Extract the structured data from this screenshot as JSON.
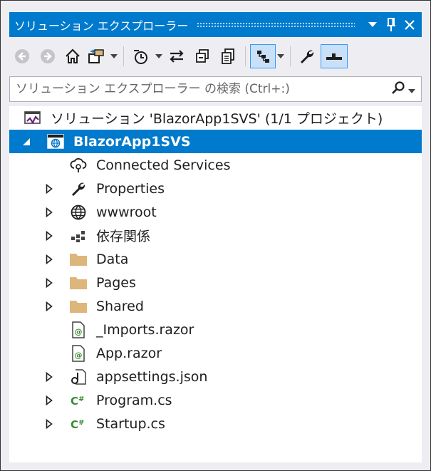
{
  "window": {
    "title": "ソリューション エクスプローラー"
  },
  "search": {
    "placeholder": "ソリューション エクスプローラー の検索 (Ctrl+:)"
  },
  "tree": {
    "solution": "ソリューション 'BlazorApp1SVS' (1/1 プロジェクト)",
    "project": "BlazorApp1SVS",
    "items": [
      {
        "label": "Connected Services",
        "icon": "connected-services-icon",
        "expandable": false
      },
      {
        "label": "Properties",
        "icon": "wrench-icon",
        "expandable": true
      },
      {
        "label": "wwwroot",
        "icon": "globe-icon",
        "expandable": true
      },
      {
        "label": "依存関係",
        "icon": "dependencies-icon",
        "expandable": true
      },
      {
        "label": "Data",
        "icon": "folder-icon",
        "expandable": true
      },
      {
        "label": "Pages",
        "icon": "folder-icon",
        "expandable": true
      },
      {
        "label": "Shared",
        "icon": "folder-icon",
        "expandable": true
      },
      {
        "label": "_Imports.razor",
        "icon": "razor-file-icon",
        "expandable": false
      },
      {
        "label": "App.razor",
        "icon": "razor-file-icon",
        "expandable": false
      },
      {
        "label": "appsettings.json",
        "icon": "json-file-icon",
        "expandable": true
      },
      {
        "label": "Program.cs",
        "icon": "csharp-file-icon",
        "expandable": true
      },
      {
        "label": "Startup.cs",
        "icon": "csharp-file-icon",
        "expandable": true
      }
    ]
  },
  "colors": {
    "accent": "#007acc",
    "panel": "#eeeef2",
    "folder": "#dcb67a",
    "csharp": "#388a34"
  }
}
